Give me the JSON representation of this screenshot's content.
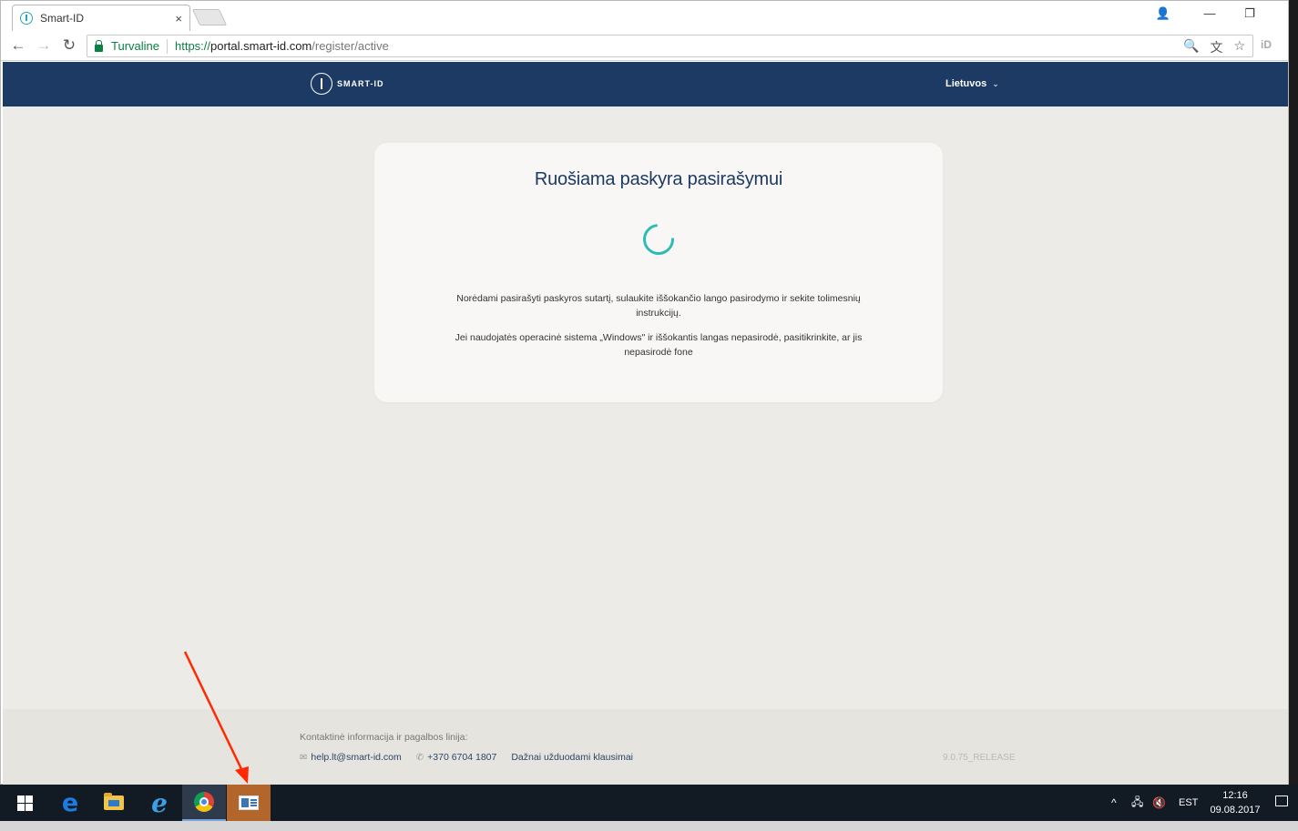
{
  "browser": {
    "tab_title": "Smart-ID",
    "tab_close": "×",
    "address": {
      "secure_label": "Turvaline",
      "url_scheme": "https://",
      "url_host": "portal.smart-id.com",
      "url_path": "/register/active"
    },
    "window_controls": {
      "profile": "👤",
      "minimize": "—",
      "restore": "❐",
      "close": "✕"
    },
    "nav": {
      "back": "←",
      "forward": "→",
      "reload": "↻"
    },
    "omni_icons": {
      "zoom": "🔍",
      "translate": "文",
      "bookmark": "☆"
    },
    "extension_label": "iD"
  },
  "site": {
    "logo_text": "SMART-ID",
    "language_label": "Lietuvos",
    "language_chevron": "⌄"
  },
  "card": {
    "title": "Ruošiama paskyra pasirašymui",
    "paragraph_1": "Norėdami pasirašyti paskyros sutartį, sulaukite iššokančio lango pasirodymo ir sekite tolimesnių instrukcijų.",
    "paragraph_2": "Jei naudojatės operacinė sistema „Windows\" ir iššokantis langas nepasirodė, pasitikrinkite, ar jis nepasirodė fone"
  },
  "footer": {
    "contact_label": "Kontaktinė informacija ir pagalbos linija:",
    "email": "help.lt@smart-id.com",
    "phone": "+370 6704 1807",
    "faq_link": "Dažnai užduodami klausimai",
    "version": "9.0.75_RELEASE"
  },
  "taskbar": {
    "edge_glyph": "e",
    "ie_glyph": "e",
    "tray_up": "^",
    "network_glyph": "🖧",
    "volume_glyph": "🔇",
    "language": "EST",
    "time": "12:16",
    "date": "09.08.2017"
  },
  "colors": {
    "header_bg": "#1c3a63",
    "accent_spinner": "#2cbcb4",
    "title_color": "#1d3a63",
    "annotation_arrow": "#ff2a00"
  }
}
